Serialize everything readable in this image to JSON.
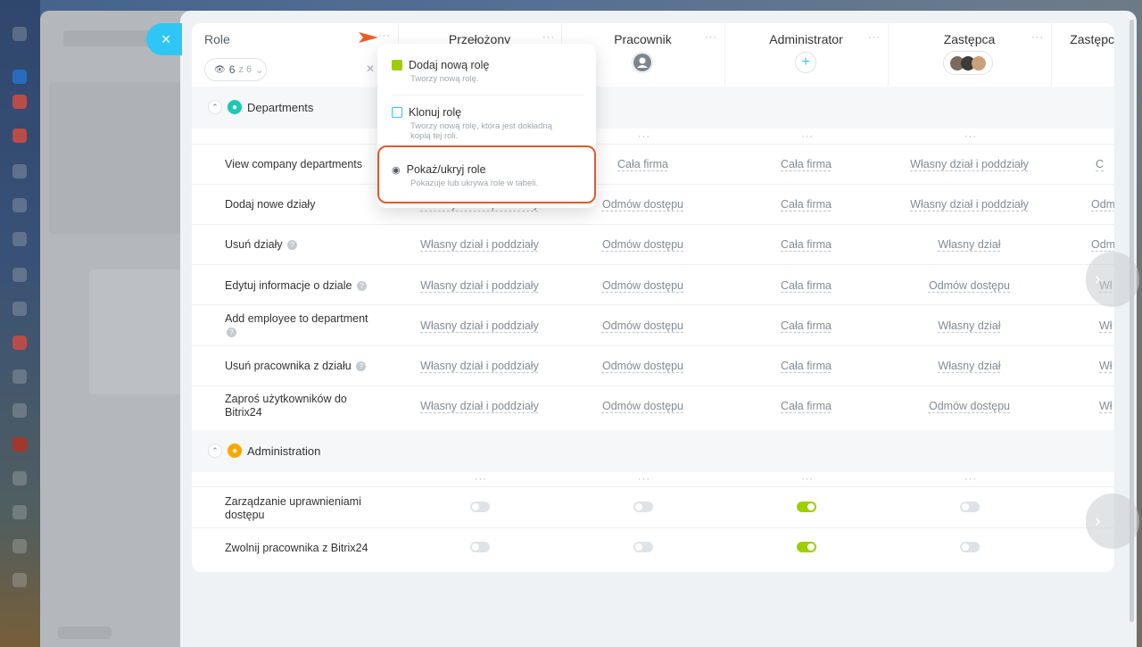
{
  "close_label": "×",
  "header": {
    "role_label": "Role",
    "visible_count": "6",
    "visible_of": "z 6",
    "columns": [
      "Przełożony",
      "Pracownik",
      "Administrator",
      "Zastępca",
      "Zastępca"
    ]
  },
  "sections": [
    {
      "title": "Departments",
      "icon": "users-icon",
      "color": "#1bc8b4",
      "rows": [
        {
          "label": "View company departments",
          "values": [
            "",
            "Cała firma",
            "Cała firma",
            "Własny dział i poddziały",
            "C"
          ]
        },
        {
          "label": "Dodaj nowe działy",
          "values": [
            "Własny dział i poddziały",
            "Odmów dostępu",
            "Cała firma",
            "Własny dział i poddziały",
            "Odm"
          ]
        },
        {
          "label": "Usuń działy",
          "help": true,
          "values": [
            "Własny dział i poddziały",
            "Odmów dostępu",
            "Cała firma",
            "Własny dział",
            "Odm"
          ]
        },
        {
          "label": "Edytuj informacje o dziale",
          "help": true,
          "values": [
            "Własny dział i poddziały",
            "Odmów dostępu",
            "Cała firma",
            "Odmów dostępu",
            "Wł"
          ]
        },
        {
          "label": "Add employee to department",
          "help": true,
          "values": [
            "Własny dział i poddziały",
            "Odmów dostępu",
            "Cała firma",
            "Własny dział",
            "Wł"
          ]
        },
        {
          "label": "Usuń pracownika z działu",
          "help": true,
          "values": [
            "Własny dział i poddziały",
            "Odmów dostępu",
            "Cała firma",
            "Własny dział",
            "Wł"
          ]
        },
        {
          "label": "Zaproś użytkowników do Bitrix24",
          "values": [
            "Własny dział i poddziały",
            "Odmów dostępu",
            "Cała firma",
            "Odmów dostępu",
            "Wł"
          ]
        }
      ]
    },
    {
      "title": "Administration",
      "icon": "person-icon",
      "color": "#f7a700",
      "rows": [
        {
          "label": "Zarządzanie uprawnieniami dostępu",
          "toggles": [
            false,
            false,
            true,
            false
          ]
        },
        {
          "label": "Zwolnij pracownika z Bitrix24",
          "toggles": [
            false,
            false,
            true,
            false
          ]
        }
      ]
    }
  ],
  "menu": {
    "items": [
      {
        "title": "Dodaj nową rolę",
        "desc": "Tworzy nową rolę.",
        "icon": "add-role-icon"
      },
      {
        "title": "Klonuj rolę",
        "desc": "Tworzy nową rolę, która jest dokładną kopią tej roli.",
        "icon": "copy-icon"
      },
      {
        "title": "Pokaż/ukryj role",
        "desc": "Pokazuje lub ukrywa role w tabeli.",
        "icon": "eye-icon"
      }
    ]
  },
  "colors": {
    "accent": "#2fc6f6",
    "highlight": "#e05a2b",
    "toggle_on": "#9dcf00"
  }
}
